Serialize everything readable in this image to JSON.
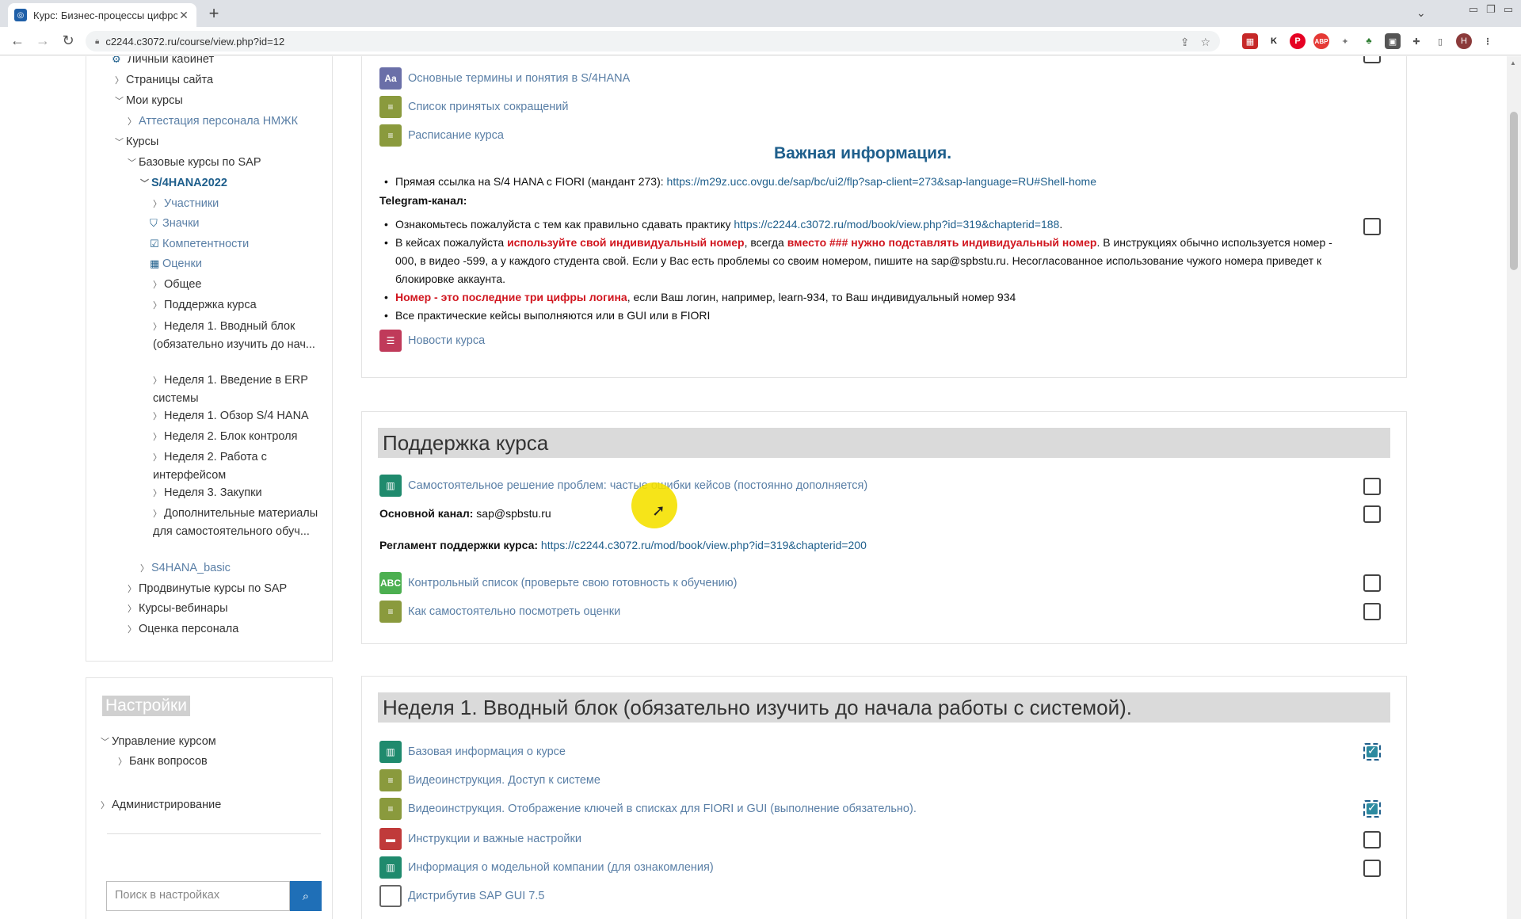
{
  "browser": {
    "tab_title": "Курс: Бизнес-процессы цифров",
    "url": "c2244.c3072.ru/course/view.php?id=12",
    "new_tab": "+",
    "avatar_letter": "Н"
  },
  "nav": {
    "items": [
      {
        "label": "Личный кабинет"
      },
      {
        "label": "Страницы сайта"
      },
      {
        "label": "Мои курсы"
      },
      {
        "label": "Аттестация персонала НМЖК"
      },
      {
        "label": "Курсы"
      },
      {
        "label": "Базовые курсы по SAP"
      },
      {
        "label": "S/4HANA2022"
      },
      {
        "label": "Участники"
      },
      {
        "label": "Значки"
      },
      {
        "label": "Компетентности"
      },
      {
        "label": "Оценки"
      },
      {
        "label": "Общее"
      },
      {
        "label": "Поддержка курса"
      },
      {
        "label": "Неделя 1. Вводный блок (обязательно изучить до нач..."
      },
      {
        "label": "Неделя 1. Введение в ERP системы"
      },
      {
        "label": "Неделя 1. Обзор S/4 HANA"
      },
      {
        "label": "Неделя 2. Блок контроля"
      },
      {
        "label": "Неделя 2. Работа с интерфейсом"
      },
      {
        "label": "Неделя 3. Закупки"
      },
      {
        "label": "Дополнительные материалы для самостоятельного обуч..."
      },
      {
        "label": "S4HANA_basic"
      },
      {
        "label": "Продвинутые курсы по SAP"
      },
      {
        "label": "Курсы-вебинары"
      },
      {
        "label": "Оценка персонала"
      }
    ]
  },
  "settings": {
    "title": "Настройки",
    "course_admin": "Управление курсом",
    "question_bank": "Банк вопросов",
    "administration": "Администрирование",
    "search_placeholder": "Поиск в настройках"
  },
  "section0": {
    "activities": [
      {
        "label": "Основные термины и понятия в S/4HANA"
      },
      {
        "label": "Список принятых сокращений"
      },
      {
        "label": "Расписание курса"
      }
    ],
    "important_title": "Важная информация.",
    "fiori_prefix": "Прямая ссылка на S/4 HANA с FIORI  (мандант 273): ",
    "fiori_link": "https://m29z.ucc.ovgu.de/sap/bc/ui2/flp?sap-client=273&sap-language=RU#Shell-home",
    "telegram": "Telegram-канал:",
    "b1_prefix": "Ознакомьтесь пожалуйста с тем как правильно сдавать практику ",
    "b1_link": "https://c2244.c3072.ru/mod/book/view.php?id=319&chapterid=188",
    "b1_suffix": ".",
    "b2_a": "В кейсах пожалуйста ",
    "b2_red1": "используйте свой индивидуальный номер",
    "b2_b": ", всегда ",
    "b2_red2": "вместо ### нужно подставлять индивидуальный номер",
    "b2_c": ". В инструкциях обычно используется номер - 000, в видео -599, а у каждого студента свой. Если у Вас есть проблемы со своим номером, пишите на sap@spbstu.ru. Несогласованное использование чужого номера приведет к блокировке аккаунта.",
    "b3_red": "Номер - это последние три цифры логина",
    "b3_rest": ", если Ваш логин, например, learn-934, то Ваш индивидуальный номер 934",
    "b4": "Все практические кейсы выполняются или в GUI или в FIORI",
    "news": "Новости курса"
  },
  "section1": {
    "title": "Поддержка курса",
    "act1": "Самостоятельное решение проблем: частые ошибки кейсов (постоянно дополняется)",
    "channel_label": "Основной канал:",
    "channel_value": " sap@spbstu.ru",
    "reg_label": "Регламент поддержки курса:",
    "reg_link": " https://c2244.c3072.ru/mod/book/view.php?id=319&chapterid=200",
    "act2": "Контрольный список (проверьте свою готовность к обучению)",
    "act3": "Как самостоятельно посмотреть оценки"
  },
  "section2": {
    "title": "Неделя 1. Вводный блок (обязательно изучить до начала работы с системой).",
    "activities": [
      {
        "label": "Базовая информация о курсе",
        "done": true
      },
      {
        "label": "Видеоинструкция. Доступ к системе",
        "done": false
      },
      {
        "label": "Видеоинструкция. Отображение ключей в списках для FIORI и GUI (выполнение обязательно).",
        "done": true
      },
      {
        "label": "Инструкции и важные настройки",
        "done": false
      },
      {
        "label": "Информация о модельной компании (для ознакомления)",
        "done": false
      },
      {
        "label": "Дистрибутив SAP GUI 7.5",
        "done": false
      }
    ]
  }
}
